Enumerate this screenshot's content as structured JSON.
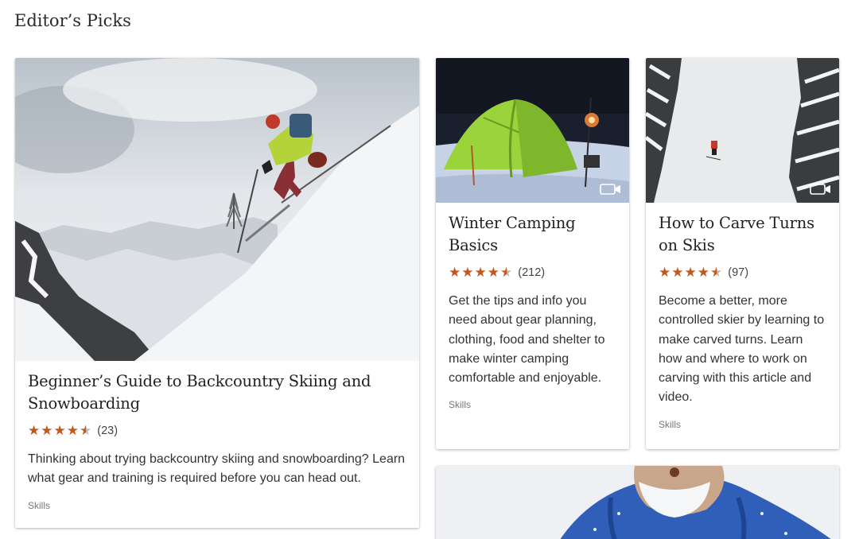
{
  "section": {
    "title": "Editor’s Picks"
  },
  "cards": [
    {
      "title": "Beginner’s Guide to Backcountry Skiing and Snowboarding",
      "rating": 4.5,
      "rating_count": "(23)",
      "description": "Thinking about trying backcountry skiing and snowboarding? Learn what gear and training is required before you can head out.",
      "tag": "Skills",
      "has_video": false
    },
    {
      "title": "Winter Camping Basics",
      "rating": 4.5,
      "rating_count": "(212)",
      "description": "Get the tips and info you need about gear planning, clothing, food and shelter to make winter camping comfortable and enjoyable.",
      "tag": "Skills",
      "has_video": true
    },
    {
      "title": "How to Carve Turns on Skis",
      "rating": 4.5,
      "rating_count": "(97)",
      "description": "Become a better, more controlled skier by learning to make carved turns. Learn how and where to work on carving with this article and video.",
      "tag": "Skills",
      "has_video": true
    }
  ],
  "colors": {
    "star": "#c4571f",
    "tag": "#777777"
  },
  "icons": {
    "rating": "star-icon",
    "media": "video-camera-icon"
  }
}
